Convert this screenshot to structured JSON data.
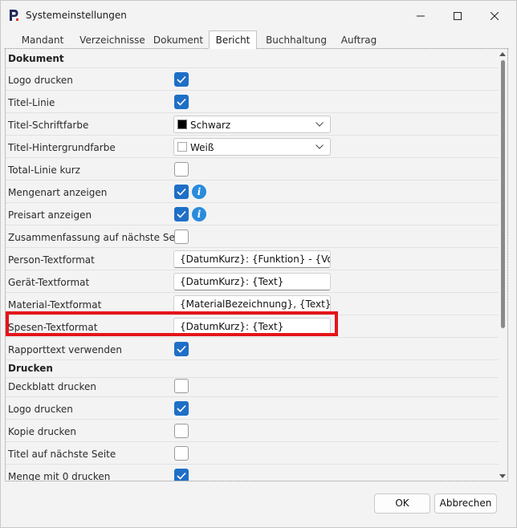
{
  "window": {
    "title": "Systemeinstellungen"
  },
  "tabs": [
    {
      "label": "Mandant"
    },
    {
      "label": "Verzeichnisse"
    },
    {
      "label": "Dokument"
    },
    {
      "label": "Bericht",
      "active": true
    },
    {
      "label": "Buchhaltung"
    },
    {
      "label": "Auftrag"
    }
  ],
  "sections": {
    "dokument": "Dokument",
    "drucken": "Drucken"
  },
  "rows": {
    "logo_drucken": {
      "label": "Logo drucken",
      "checked": true
    },
    "titel_linie": {
      "label": "Titel-Linie",
      "checked": true
    },
    "titel_schriftfarbe": {
      "label": "Titel-Schriftfarbe",
      "value": "Schwarz",
      "swatch": "#000000"
    },
    "titel_hintergrundfarbe": {
      "label": "Titel-Hintergrundfarbe",
      "value": "Weiß",
      "swatch": "#ffffff"
    },
    "total_linie_kurz": {
      "label": "Total-Linie kurz",
      "checked": false
    },
    "mengenart_anzeigen": {
      "label": "Mengenart anzeigen",
      "checked": true
    },
    "preisart_anzeigen": {
      "label": "Preisart anzeigen",
      "checked": true
    },
    "zusammenfassung": {
      "label": "Zusammenfassung auf nächste Seite",
      "checked": false
    },
    "person_textformat": {
      "label": "Person-Textformat",
      "value": "{DatumKurz}: {Funktion} - {Vorname}"
    },
    "geraet_textformat": {
      "label": "Gerät-Textformat",
      "value": "{DatumKurz}: {Text}"
    },
    "material_textformat": {
      "label": "Material-Textformat",
      "value": "{MaterialBezeichnung}, {Text}"
    },
    "spesen_textformat": {
      "label": "Spesen-Textformat",
      "value": "{DatumKurz}: {Text}"
    },
    "rapporttext": {
      "label": "Rapporttext verwenden",
      "checked": true
    },
    "deckblatt_drucken": {
      "label": "Deckblatt drucken",
      "checked": false
    },
    "logo_drucken_2": {
      "label": "Logo drucken",
      "checked": true
    },
    "kopie_drucken": {
      "label": "Kopie drucken",
      "checked": false
    },
    "titel_naechste_seite": {
      "label": "Titel auf nächste Seite",
      "checked": false
    },
    "menge_mit_0": {
      "label": "Menge mit 0 drucken",
      "checked": true
    }
  },
  "buttons": {
    "ok": "OK",
    "cancel": "Abbrechen"
  },
  "colors": {
    "accent": "#1f6fc7",
    "highlight": "#e5141b",
    "info": "#2a8bdc"
  },
  "icons": {
    "info": "i"
  }
}
